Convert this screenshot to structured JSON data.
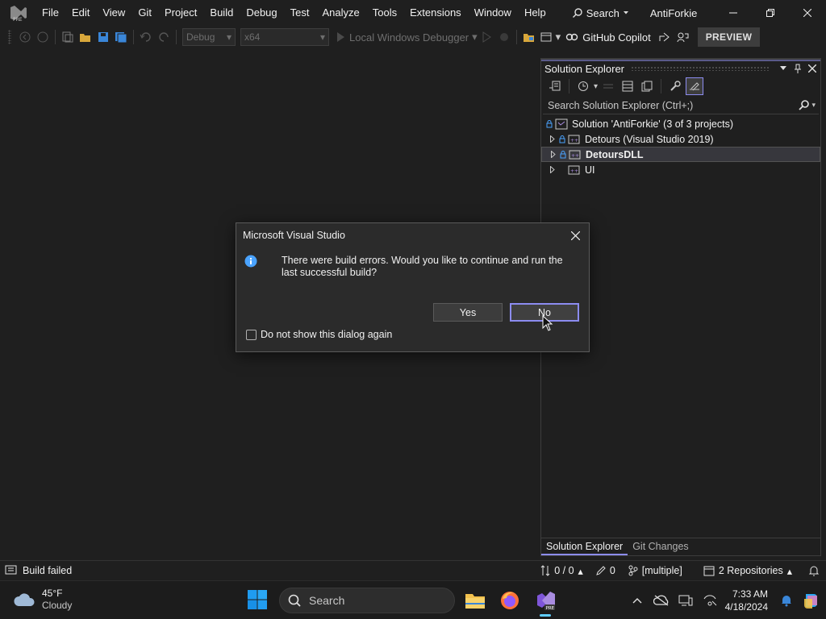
{
  "menubar": {
    "items": [
      "File",
      "Edit",
      "View",
      "Git",
      "Project",
      "Build",
      "Debug",
      "Test",
      "Analyze",
      "Tools",
      "Extensions",
      "Window",
      "Help"
    ],
    "search_label": "Search",
    "app_name": "AntiForkie"
  },
  "toolbar": {
    "config": "Debug",
    "platform": "x64",
    "debugger": "Local Windows Debugger",
    "copilot": "GitHub Copilot",
    "preview": "PREVIEW"
  },
  "solution_explorer": {
    "title": "Solution Explorer",
    "search_placeholder": "Search Solution Explorer (Ctrl+;)",
    "solution": "Solution 'AntiForkie' (3 of 3 projects)",
    "projects": [
      "Detours (Visual Studio 2019)",
      "DetoursDLL",
      "UI"
    ],
    "tabs": [
      "Solution Explorer",
      "Git Changes"
    ]
  },
  "dialog": {
    "title": "Microsoft Visual Studio",
    "message": "There were build errors. Would you like to continue and run the last successful build?",
    "yes": "Yes",
    "no": "No",
    "checkbox": "Do not show this dialog again"
  },
  "statusbar": {
    "status": "Build failed",
    "commits": "0 / 0",
    "changes": "0",
    "branch": "[multiple]",
    "repos": "2 Repositories"
  },
  "taskbar": {
    "temp": "45°F",
    "condition": "Cloudy",
    "search": "Search",
    "time": "7:33 AM",
    "date": "4/18/2024"
  },
  "colors": {
    "accent": "#8c8cf0",
    "background": "#1f1f1f",
    "dialog": "#2b2b2b",
    "info": "#4aa3ff"
  }
}
